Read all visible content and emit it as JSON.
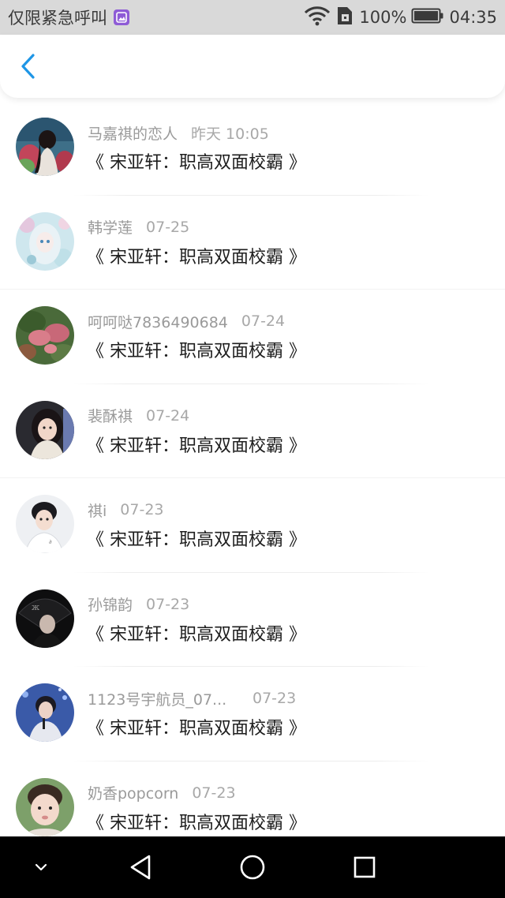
{
  "status_bar": {
    "carrier": "仅限紧急呼叫",
    "battery": "100%",
    "time": "04:35"
  },
  "header": {
    "back_icon": "chevron-left-icon",
    "accent_color": "#1e96e6"
  },
  "messages": [
    {
      "name": "马嘉祺的恋人",
      "time": "昨天 10:05",
      "text": "《 宋亚轩：职高双面校霸 》"
    },
    {
      "name": "韩学莲",
      "time": "07-25",
      "text": "《 宋亚轩：职高双面校霸 》"
    },
    {
      "name": "呵呵哒7836490684",
      "time": "07-24",
      "text": "《 宋亚轩：职高双面校霸 》"
    },
    {
      "name": "裴酥祺",
      "time": "07-24",
      "text": "《 宋亚轩：职高双面校霸 》"
    },
    {
      "name": "祺i",
      "time": "07-23",
      "text": "《 宋亚轩：职高双面校霸 》"
    },
    {
      "name": "孙锦韵",
      "time": "07-23",
      "text": "《 宋亚轩：职高双面校霸 》"
    },
    {
      "name": "1123号宇航员_07...",
      "time": "07-23",
      "text": "《 宋亚轩：职高双面校霸 》"
    },
    {
      "name": "奶香popcorn",
      "time": "07-23",
      "text": "《 宋亚轩：职高双面校霸 》"
    }
  ],
  "nav_bar": {
    "icons": [
      "chevron-down-icon",
      "back-triangle-icon",
      "home-circle-icon",
      "recents-square-icon"
    ]
  }
}
